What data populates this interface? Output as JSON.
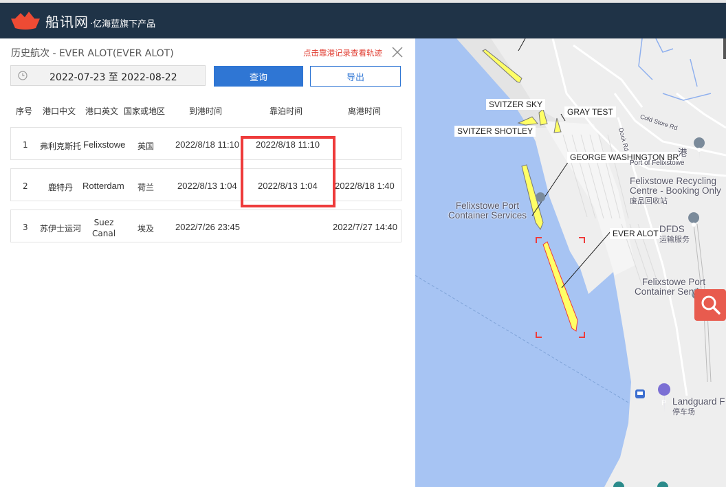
{
  "header": {
    "brand": "船讯网",
    "tagline": "·亿海蓝旗下产品"
  },
  "panel": {
    "title": "历史航次 - EVER ALOT(EVER ALOT)",
    "hint": "点击靠港记录查看轨迹",
    "date_range": "2022-07-23 至 2022-08-22",
    "query_button": "查询",
    "export_button": "导出"
  },
  "table": {
    "columns": [
      "序号",
      "港口中文",
      "港口英文",
      "国家或地区",
      "到港时间",
      "靠泊时间",
      "离港时间"
    ],
    "rows": [
      {
        "no": "1",
        "port_cn": "弗利克斯托",
        "port_en": "Felixstowe",
        "country": "英国",
        "arrival": "2022/8/18 11:10",
        "berth": "2022/8/18 11:10",
        "departure": ""
      },
      {
        "no": "2",
        "port_cn": "鹿特丹",
        "port_en": "Rotterdam",
        "country": "荷兰",
        "arrival": "2022/8/13 1:04",
        "berth": "2022/8/13 1:04",
        "departure": "2022/8/18 1:40"
      },
      {
        "no": "3",
        "port_cn": "苏伊士运河",
        "port_en_line1": "Suez",
        "port_en_line2": "Canal",
        "country": "埃及",
        "arrival": "2022/7/26 23:45",
        "berth": "",
        "departure": "2022/7/27 14:40"
      }
    ]
  },
  "map": {
    "ship_labels": [
      "SVITZER SKY",
      "GRAY TEST",
      "SVITZER SHOTLEY",
      "GEORGE WASHINGTON BR",
      "EVER ALOT"
    ],
    "places": {
      "felix_port_left_1": "Felixstowe Port",
      "felix_port_left_2": "Container Services",
      "recycling_1": "Felixstowe Recycling",
      "recycling_2": "Centre - Booking Only",
      "recycling_cn": "废品回收站",
      "dfds": "DFDS",
      "dfds_cn": "运输服务",
      "felix_port_right_1": "Felixstowe Port",
      "felix_port_right_2": "Container Services",
      "port_cn": "港",
      "port_sub": "Port of Felixstowe",
      "landguard": "Landguard F",
      "parking_cn": "停车场",
      "cold_store": "Cold Store Rd",
      "dock_rd": "Dock Rd"
    },
    "colors": {
      "sea": "#a7c4f3",
      "land": "#eeeeee",
      "ship_fill": "#ffff66",
      "selected_ship": "#ff5a3c",
      "accent": "#2f76d4"
    }
  }
}
